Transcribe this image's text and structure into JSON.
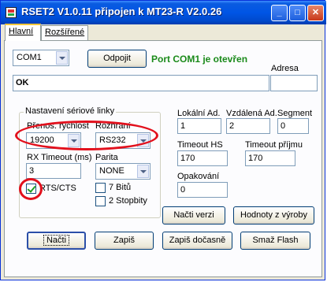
{
  "window": {
    "title": "RSET2 V1.0.11 připojen k MT23-R V2.0.26",
    "title_color": "#0055e5",
    "minimize_glyph": "_",
    "maximize_glyph": "□",
    "close_glyph": "✕"
  },
  "tabs": [
    {
      "label": "Hlavní",
      "active": true
    },
    {
      "label": "Rozšířené",
      "active": false
    }
  ],
  "port": {
    "selected": "COM1",
    "disconnect_label": "Odpojit",
    "status_text": "Port COM1 je otevřen",
    "status_color": "#1a8a1a"
  },
  "adresa": {
    "label": "Adresa",
    "value": ""
  },
  "response": {
    "value": "OK"
  },
  "serial": {
    "legend": "Nastavení sériové linky",
    "speed_label": "Přenos. rychlost",
    "speed_value": "19200",
    "interface_label": "Rozhraní",
    "interface_value": "RS232",
    "rx_timeout_label": "RX Timeout (ms)",
    "rx_timeout_value": "3",
    "parity_label": "Parita",
    "parity_value": "NONE",
    "rts_label": "RTS/CTS",
    "rts_checked": true,
    "bits7_label": "7 Bitů",
    "bits7_checked": false,
    "stopbits_label": "2 Stopbity",
    "stopbits_checked": false
  },
  "params": {
    "local_label": "Lokální Ad.",
    "local_value": "1",
    "remote_label": "Vzdálená Ad.",
    "remote_value": "2",
    "segment_label": "Segment",
    "segment_value": "0",
    "timeout_hs_label": "Timeout HS",
    "timeout_hs_value": "170",
    "timeout_rx_label": "Timeout příjmu",
    "timeout_rx_value": "170",
    "retries_label": "Opakování",
    "retries_value": "0"
  },
  "buttons": {
    "read_version": "Načti verzi",
    "factory_values": "Hodnoty z výroby",
    "read": "Načti",
    "write": "Zapiš",
    "write_temp": "Zapiš dočasně",
    "erase_flash": "Smaž Flash"
  },
  "annotation_color": "#e2101c"
}
